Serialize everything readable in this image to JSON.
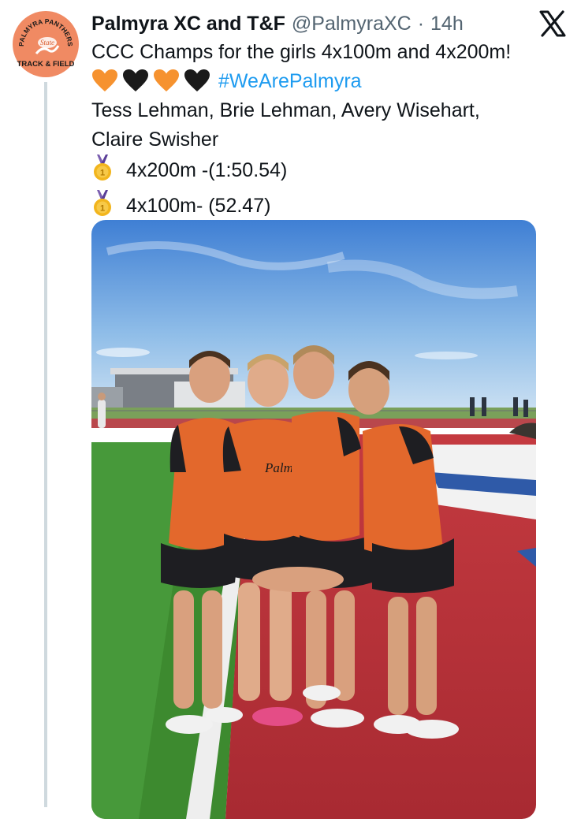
{
  "author": {
    "display_name": "Palmyra XC and T&F",
    "handle": "@PalmyraXC",
    "separator": "·",
    "time": "14h",
    "avatar_text": {
      "top": "PALMYRA PANTHERS",
      "middle": "State",
      "bottom": "TRACK & FIELD"
    }
  },
  "tweet": {
    "line1": "CCC Champs for the girls 4x100m and 4x200m!",
    "hearts": [
      "orange-heart-emoji",
      "black-heart-emoji",
      "orange-heart-emoji",
      "black-heart-emoji"
    ],
    "hashtag": "#WeArePalmyra",
    "line3": "Tess Lehman, Brie Lehman, Avery Wisehart,",
    "line4": "Claire Swisher",
    "results": [
      {
        "icon": "gold-medal-emoji",
        "text": "4x200m -(1:50.54)"
      },
      {
        "icon": "gold-medal-emoji",
        "text": "4x100m- (52.47)"
      }
    ]
  },
  "media": {
    "jersey_text": "Palmyra"
  },
  "colors": {
    "accent": "#1d9bf0",
    "text": "#0f1419",
    "muted": "#536471",
    "orange": "#f58f3a",
    "avatar_bg": "#f08a63"
  }
}
